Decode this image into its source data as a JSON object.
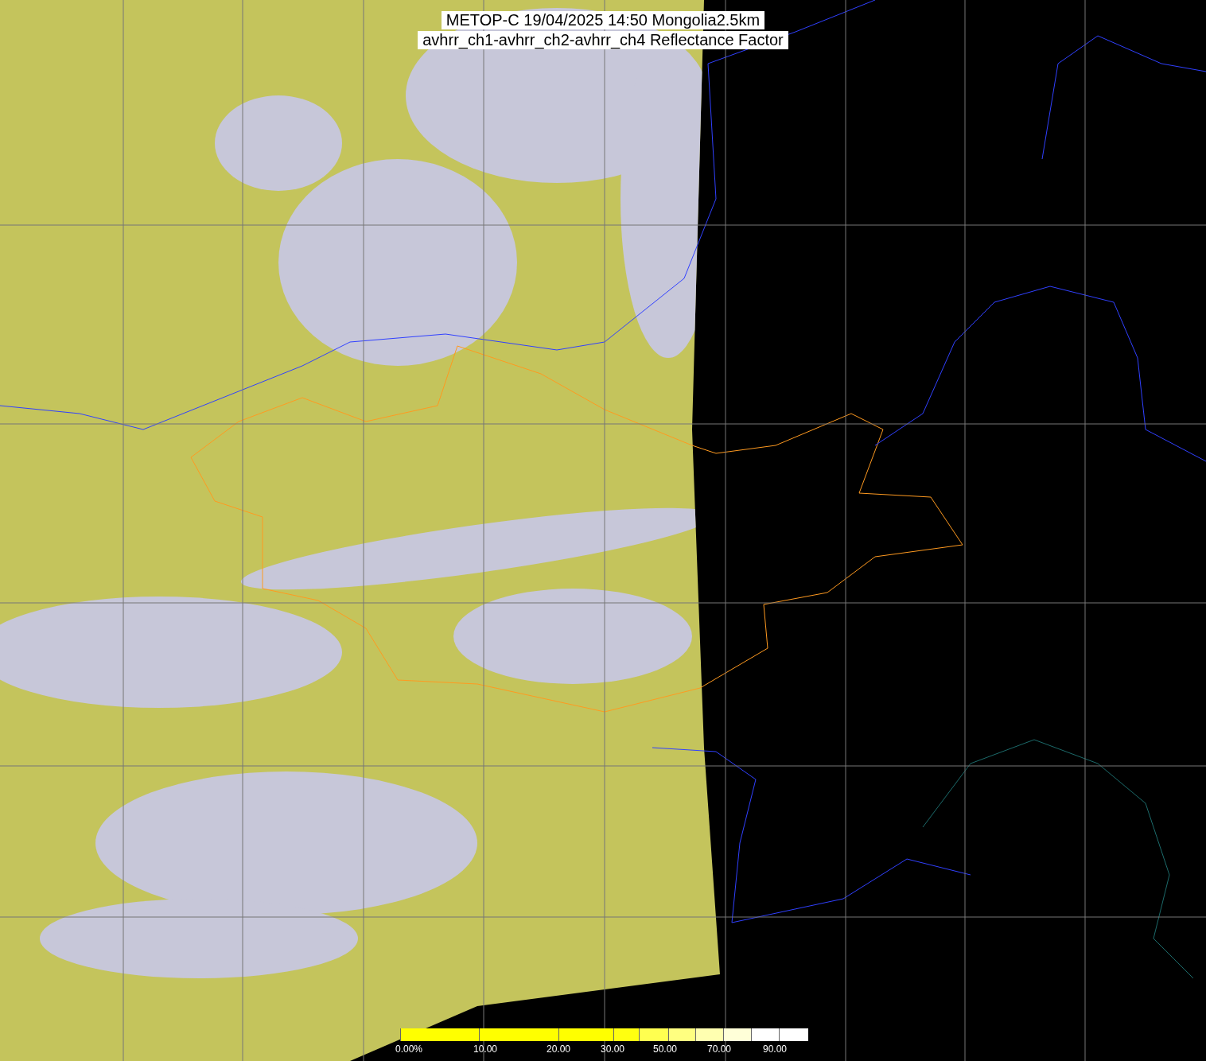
{
  "title": {
    "lines": [
      "METOP-C 19/04/2025 14:50 Mongolia2.5km",
      "avhrr_ch1-avhrr_ch2-avhrr_ch4 Reflectance Factor"
    ]
  },
  "colorbar": {
    "ticks": [
      "0.00%",
      "10.00",
      "20.00",
      "30.00",
      "50.00",
      "70.00",
      "90.00"
    ]
  }
}
